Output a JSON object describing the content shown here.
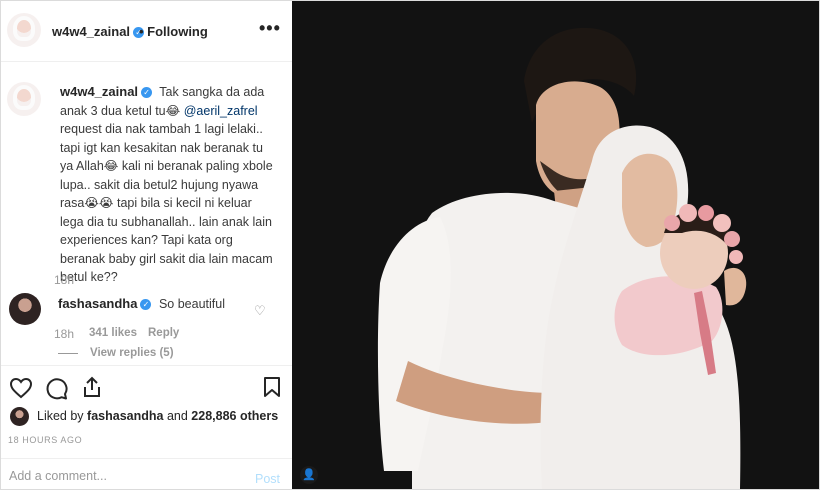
{
  "header": {
    "username": "w4w4_zainal",
    "follow_status": "• Following",
    "more": "•••"
  },
  "caption": {
    "username": "w4w4_zainal",
    "lines": [
      "Tak sangka da ada",
      "anak 3 dua ketul tu😂",
      "request dia nak tambah 1 lagi lelaki..",
      "tapi igt kan kesakitan nak beranak tu",
      "ya Allah😂 kali ni beranak paling xbole",
      "lupa.. sakit dia betul2 hujung nyawa",
      "rasa😭😭 tapi bila si kecil ni keluar",
      "lega dia tu subhanallah.. lain anak lain",
      "experiences kan? Tapi kata org",
      "beranak baby girl sakit dia lain macam",
      "betul ke??"
    ],
    "mention": "@aeril_zafrel",
    "time": "18h"
  },
  "comment": {
    "username": "fashasandha",
    "text": "So beautiful",
    "time": "18h",
    "likes": "341 likes",
    "reply": "Reply",
    "view_replies": "View replies (5)"
  },
  "actions": {
    "like_icon": "heart-icon",
    "comment_icon": "comment-icon",
    "share_icon": "share-icon",
    "save_icon": "bookmark-icon"
  },
  "likes_summary": {
    "prefix": "Liked by",
    "user": "fashasandha",
    "middle": "and",
    "count": "228,886 others"
  },
  "post_age": "18 HOURS AGO",
  "add_comment": {
    "placeholder": "Add a comment...",
    "post_label": "Post"
  },
  "colors": {
    "verified": "#3897f0",
    "post_disabled": "#b2dffc",
    "photo_bg": "#111111"
  }
}
